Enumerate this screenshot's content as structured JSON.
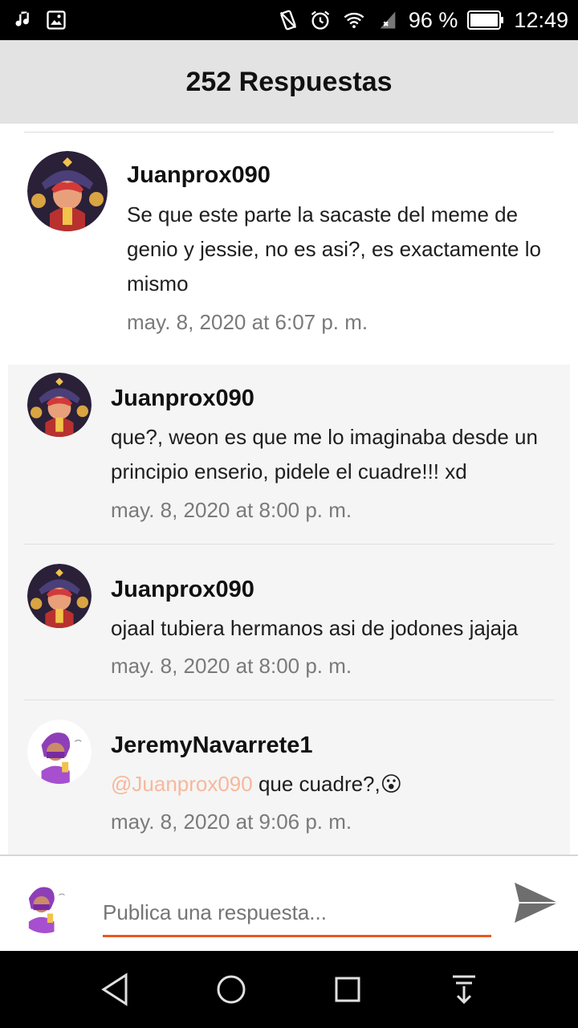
{
  "status_bar": {
    "battery_percent": "96 %",
    "time": "12:49"
  },
  "header": {
    "title": "252 Respuestas"
  },
  "comments": [
    {
      "author": "Juanprox090",
      "text": "Se que este parte la sacaste del meme de genio y jessie, no es asi?, es exactamente lo mismo",
      "time": "may. 8, 2020 at 6:07 p. m."
    }
  ],
  "replies": [
    {
      "author": "Juanprox090",
      "text": "que?, weon es que me lo imaginaba desde un principio enserio, pidele el cuadre!!! xd",
      "time": "may. 8, 2020 at 8:00 p. m."
    },
    {
      "author": "Juanprox090",
      "text": "ojaal tubiera hermanos asi de jodones jajaja",
      "time": "may. 8, 2020 at 8:00 p. m."
    },
    {
      "author": "JeremyNavarrete1",
      "mention": "@Juanprox090",
      "text": " que cuadre?,😮",
      "time": "may. 8, 2020 at 9:06 p. m."
    }
  ],
  "composer": {
    "placeholder": "Publica una respuesta..."
  },
  "colors": {
    "accent": "#e8581f",
    "mention": "#f6b89c",
    "header_bg": "#e3e3e3"
  }
}
